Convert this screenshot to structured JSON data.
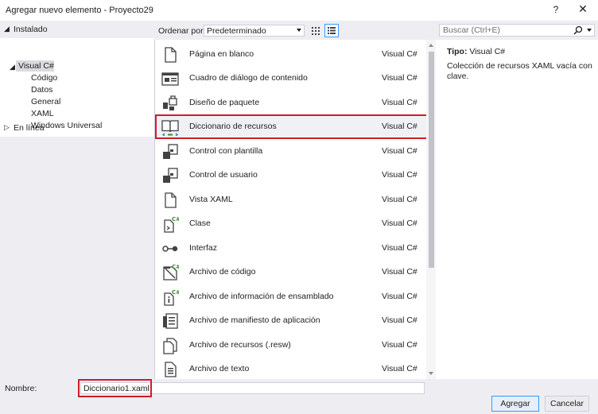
{
  "window": {
    "title": "Agregar nuevo elemento - Proyecto29",
    "help_label": "?",
    "close_label": "✕"
  },
  "left_panel": {
    "installed_label": "Instalado",
    "tree": [
      {
        "label": "Visual C#",
        "selected": true
      },
      {
        "label": "Código"
      },
      {
        "label": "Datos"
      },
      {
        "label": "General"
      },
      {
        "label": "XAML"
      },
      {
        "label": "Windows Universal"
      }
    ],
    "online_label": "En línea"
  },
  "toolbar": {
    "sort_label": "Ordenar por:",
    "sort_value": "Predeterminado"
  },
  "items": [
    {
      "name": "Página en blanco",
      "lang": "Visual C#",
      "icon": "blank-page-icon"
    },
    {
      "name": "Cuadro de diálogo de contenido",
      "lang": "Visual C#",
      "icon": "content-dialog-icon"
    },
    {
      "name": "Diseño de paquete",
      "lang": "Visual C#",
      "icon": "package-design-icon"
    },
    {
      "name": "Diccionario de recursos",
      "lang": "Visual C#",
      "icon": "resource-dictionary-icon",
      "selected": true
    },
    {
      "name": "Control con plantilla",
      "lang": "Visual C#",
      "icon": "templated-control-icon"
    },
    {
      "name": "Control de usuario",
      "lang": "Visual C#",
      "icon": "user-control-icon"
    },
    {
      "name": "Vista XAML",
      "lang": "Visual C#",
      "icon": "xaml-view-icon"
    },
    {
      "name": "Clase",
      "lang": "Visual C#",
      "icon": "class-icon"
    },
    {
      "name": "Interfaz",
      "lang": "Visual C#",
      "icon": "interface-icon"
    },
    {
      "name": "Archivo de código",
      "lang": "Visual C#",
      "icon": "code-file-icon"
    },
    {
      "name": "Archivo de información de ensamblado",
      "lang": "Visual C#",
      "icon": "assembly-info-icon"
    },
    {
      "name": "Archivo de manifiesto de aplicación",
      "lang": "Visual C#",
      "icon": "app-manifest-icon"
    },
    {
      "name": "Archivo de recursos (.resw)",
      "lang": "Visual C#",
      "icon": "resw-file-icon"
    },
    {
      "name": "Archivo de texto",
      "lang": "Visual C#",
      "icon": "text-file-icon"
    }
  ],
  "search": {
    "placeholder": "Buscar (Ctrl+E)"
  },
  "details": {
    "type_label": "Tipo:",
    "type_value": "Visual C#",
    "description": "Colección de recursos XAML vacía con clave."
  },
  "bottom": {
    "name_label": "Nombre:",
    "name_value": "Diccionario1.xaml",
    "add_label": "Agregar",
    "cancel_label": "Cancelar"
  },
  "colors": {
    "highlight": "#d11c28",
    "accent": "#3399ff",
    "icon_green": "#388a34",
    "icon_dark": "#424242"
  }
}
